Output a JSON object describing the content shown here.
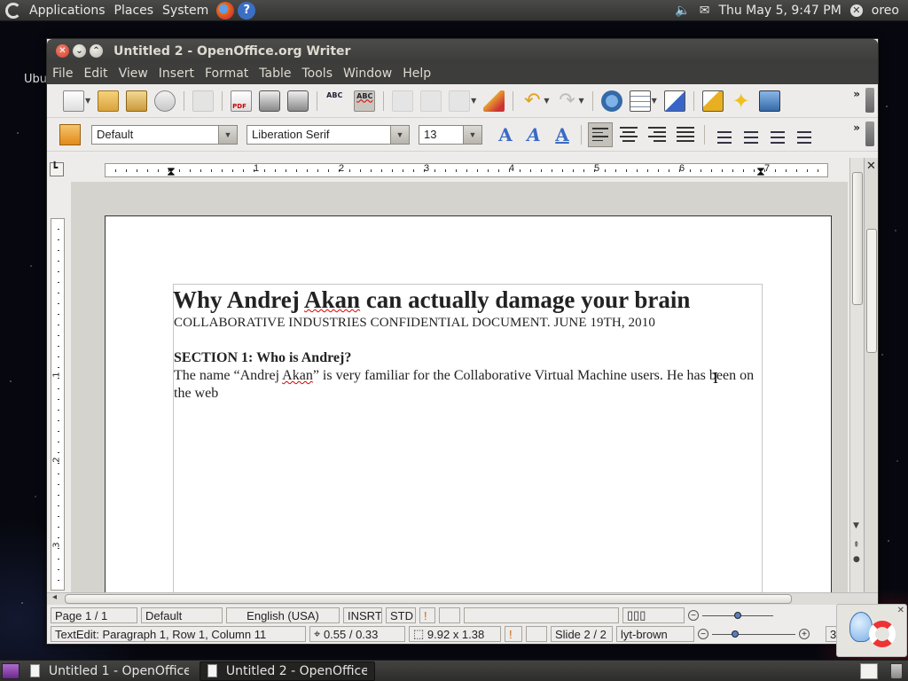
{
  "top_panel": {
    "menus": [
      "Applications",
      "Places",
      "System"
    ],
    "clock": "Thu May  5,  9:47 PM",
    "user": "oreo"
  },
  "desktop": {
    "partial_label": "Ubu"
  },
  "window": {
    "title": "Untitled 2 - OpenOffice.org Writer",
    "menu": [
      "File",
      "Edit",
      "View",
      "Insert",
      "Format",
      "Table",
      "Tools",
      "Window",
      "Help"
    ]
  },
  "format_bar": {
    "paragraph_style": "Default",
    "font_name": "Liberation Serif",
    "font_size": "13"
  },
  "ruler": {
    "h_numbers": [
      "1",
      "2",
      "3",
      "4",
      "5",
      "6",
      "7"
    ],
    "v_numbers": [
      "1",
      "2",
      "3"
    ]
  },
  "document": {
    "title_prefix": "Why Andrej ",
    "title_misspelled": "Akan",
    "title_suffix": " can actually damage your brain",
    "subtitle": "COLLABORATIVE INDUSTRIES CONFIDENTIAL DOCUMENT. JUNE 19TH, 2010",
    "section_heading": "SECTION 1: Who is Andrej?",
    "body_prefix": "The name “Andrej ",
    "body_misspelled": "Akan",
    "body_suffix": "” is very familiar for the Collaborative Virtual Machine users. He has been on the web"
  },
  "status_bar_1": {
    "page": "Page 1 / 1",
    "style": "Default",
    "language": "English (USA)",
    "insert_mode": "INSRT",
    "selection_mode": "STD"
  },
  "status_bar_2": {
    "context": "TextEdit: Paragraph 1, Row 1, Column 11",
    "position": "0.55 / 0.33",
    "size": "9.92 x 1.38",
    "slide": "Slide 2 / 2",
    "layout": "lyt-brown",
    "zoom": "37%"
  },
  "taskbar": {
    "tasks": [
      "Untitled 1 - OpenOffice....",
      "Untitled 2 - OpenOffice...."
    ]
  },
  "colors": {
    "panel": "#3b3b39",
    "spell_underline": "#dd0000",
    "workspace": "#d5d3ce"
  }
}
